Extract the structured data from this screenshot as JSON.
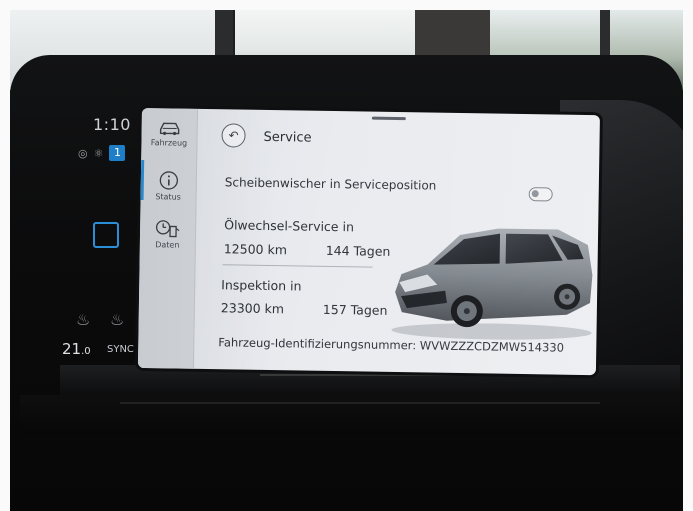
{
  "climate": {
    "time": "1:10",
    "badge": "1",
    "temperature": "21",
    "temperature_decimal": ".0",
    "sync_label": "SYNC"
  },
  "sidebar": {
    "items": [
      {
        "label": "Fahrzeug",
        "icon": "car-icon"
      },
      {
        "label": "Status",
        "icon": "info-icon"
      },
      {
        "label": "Daten",
        "icon": "fuel-data-icon"
      }
    ],
    "active": "Status"
  },
  "header": {
    "title": "Service"
  },
  "service": {
    "wiper_label": "Scheibenwischer in Serviceposition",
    "wiper_on": false,
    "oil_label": "Ölwechsel-Service in",
    "oil_km": "12500 km",
    "oil_days": "144 Tagen",
    "inspection_label": "Inspektion in",
    "inspection_km": "23300 km",
    "inspection_days": "157 Tagen",
    "vin_line": "Fahrzeug-Identifizierungsnummer: WVWZZZCDZMW514330"
  },
  "colors": {
    "accent": "#2b8fd8",
    "screen_bg": "#e9ebef",
    "car": "#8a8f96"
  }
}
